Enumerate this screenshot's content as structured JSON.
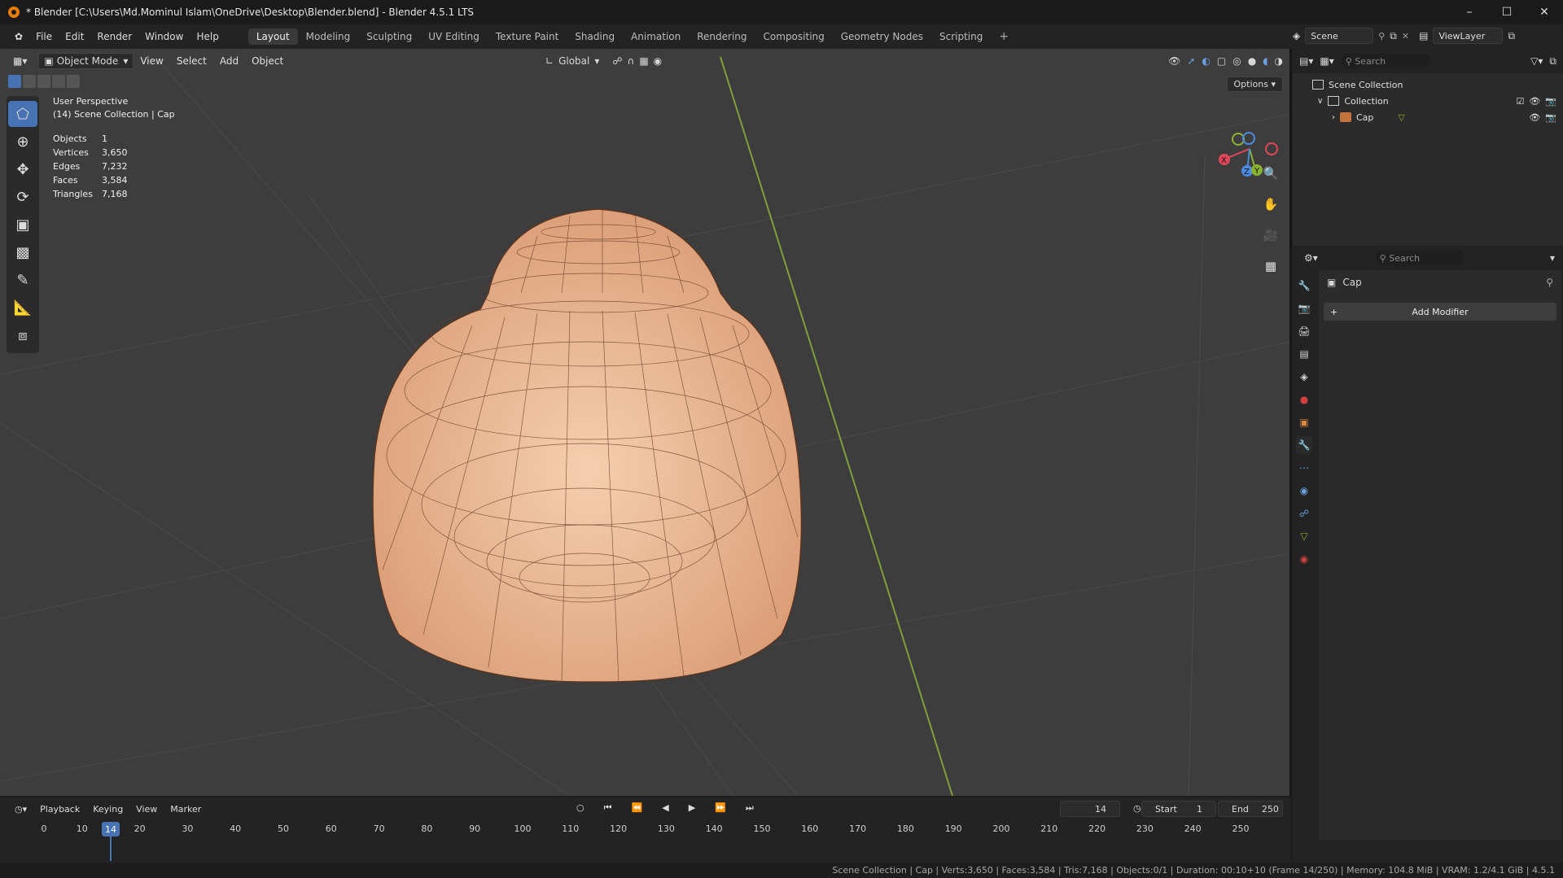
{
  "window": {
    "title": "* Blender [C:\\Users\\Md.Mominul Islam\\OneDrive\\Desktop\\Blender.blend] - Blender 4.5.1 LTS"
  },
  "menus": [
    "File",
    "Edit",
    "Render",
    "Window",
    "Help"
  ],
  "workspaces": [
    "Layout",
    "Modeling",
    "Sculpting",
    "UV Editing",
    "Texture Paint",
    "Shading",
    "Animation",
    "Rendering",
    "Compositing",
    "Geometry Nodes",
    "Scripting"
  ],
  "active_workspace": "Layout",
  "scene": {
    "scene_label": "Scene",
    "viewlayer_label": "ViewLayer"
  },
  "viewport": {
    "mode": "Object Mode",
    "menus": [
      "View",
      "Select",
      "Add",
      "Object"
    ],
    "transform_orientation": "Global",
    "options_label": "Options",
    "overlay_title": "User Perspective",
    "overlay_sub": "(14) Scene Collection | Cap",
    "stats": [
      {
        "label": "Objects",
        "value": "1"
      },
      {
        "label": "Vertices",
        "value": "3,650"
      },
      {
        "label": "Edges",
        "value": "7,232"
      },
      {
        "label": "Faces",
        "value": "3,584"
      },
      {
        "label": "Triangles",
        "value": "7,168"
      }
    ],
    "gizmo_axes": [
      "X",
      "Y",
      "Z"
    ]
  },
  "outliner": {
    "search_placeholder": "Search",
    "items": [
      {
        "label": "Scene Collection"
      },
      {
        "label": "Collection"
      },
      {
        "label": "Cap"
      }
    ]
  },
  "properties": {
    "search_placeholder": "Search",
    "object_name": "Cap",
    "add_modifier_label": "Add Modifier"
  },
  "timeline": {
    "menus": [
      "Playback",
      "Keying",
      "View",
      "Marker"
    ],
    "current_frame": "14",
    "start_label": "Start",
    "start_value": "1",
    "end_label": "End",
    "end_value": "250",
    "ticks": [
      "0",
      "10",
      "20",
      "30",
      "40",
      "50",
      "60",
      "70",
      "80",
      "90",
      "100",
      "110",
      "120",
      "130",
      "140",
      "150",
      "160",
      "170",
      "180",
      "190",
      "200",
      "210",
      "220",
      "230",
      "240",
      "250"
    ]
  },
  "statusbar": {
    "text": "Scene Collection | Cap | Verts:3,650 | Faces:3,584 | Tris:7,168 | Objects:0/1 | Duration: 00:10+10 (Frame 14/250) | Memory: 104.8 MiB | VRAM: 1.2/4.1 GiB | 4.5.1"
  },
  "colors": {
    "accent": "#4772b3",
    "mesh": "#e8b48f",
    "y_axis": "#8ab332",
    "x_axis": "#e0475a",
    "z_axis": "#4a8be0"
  }
}
